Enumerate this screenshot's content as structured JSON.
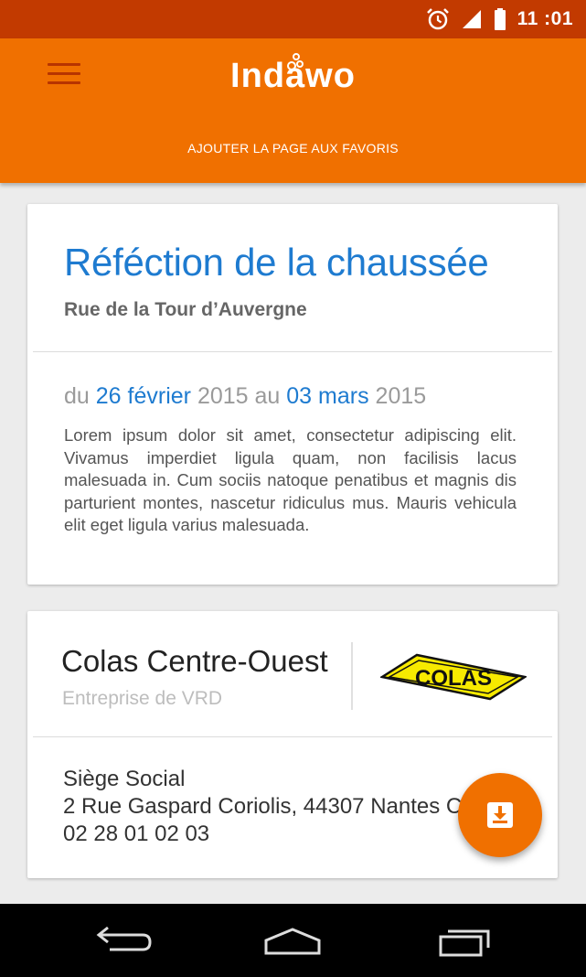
{
  "status_bar": {
    "time": "11 :01",
    "icons": [
      "alarm-icon",
      "signal-icon",
      "battery-icon"
    ]
  },
  "app_bar": {
    "app_name": "Indawo",
    "favorites_link": "AJOUTER LA PAGE AUX FAVORIS",
    "colors": {
      "status": "#c23a00",
      "primary": "#f07000",
      "menu_icon": "#b73400"
    }
  },
  "event_card": {
    "title": "Réféction de la chaussée",
    "street": "Rue de la Tour d’Auvergne",
    "dates": {
      "from_word": "du",
      "from_date": "26 février",
      "from_year": "2015",
      "to_word": "au",
      "to_date": "03 mars",
      "to_year": "2015"
    },
    "description": "Lorem ipsum dolor sit amet, consectetur adipiscing elit. Vivamus imperdiet ligula quam, non facilisis lacus malesuada in. Cum sociis natoque penatibus et magnis dis parturient montes, nascetur ridiculus mus. Mauris vehicula elit eget ligula varius malesuada.",
    "accent_color": "#1e7bd0"
  },
  "company_card": {
    "name": "Colas Centre-Ouest",
    "type": "Entreprise de VRD",
    "logo_text": "COLAS",
    "address_title": "Siège Social",
    "address": "2 Rue Gaspard Coriolis, 44307 Nantes C",
    "phone": "02 28 01 02 03"
  },
  "fab": {
    "icon": "download-box-icon"
  },
  "nav_bar": {
    "buttons": [
      "back-icon",
      "home-icon",
      "recents-icon"
    ]
  }
}
